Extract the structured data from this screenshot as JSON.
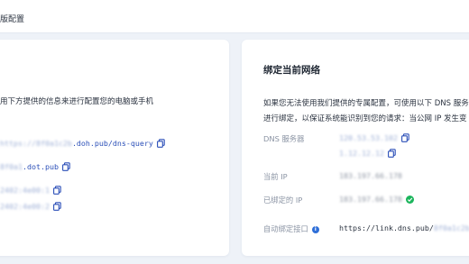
{
  "header": {
    "breadcrumb": "版配置"
  },
  "left_card": {
    "description": "用下方提供的信息来进行配置您的电脑或手机",
    "entries": [
      {
        "prefix_blurred": "https://8f0a1c2b",
        "text": ".doh.pub/dns-query"
      },
      {
        "prefix_blurred": "8f0a1",
        "text": ".dot.pub"
      },
      {
        "prefix_blurred": "2402:4e00:1",
        "text": ""
      },
      {
        "prefix_blurred": "2402:4e00:2",
        "text": ""
      }
    ]
  },
  "right_card": {
    "title": "绑定当前网络",
    "description_line1": "如果您无法使用我们提供的专属配置，可使用以下 DNS 服务",
    "description_line2": "进行绑定，以保证系统能识别到您的请求：当公网 IP 发生变",
    "labels": {
      "dns_server": "DNS 服务器",
      "current_ip": "当前 IP",
      "bound_ip": "已绑定的 IP",
      "auto_bind": "自动绑定接口"
    },
    "dns_servers": [
      "120.53.53.102",
      "1.12.12.12"
    ],
    "current_ip": "183.197.66.178",
    "bound_ip": "183.197.66.178",
    "auto_bind_url": "https://link.dns.pub/",
    "auto_bind_url_blurred": "8f0a1c2b3d"
  },
  "colors": {
    "link": "#2b4fb8",
    "success": "#1bb55c",
    "info": "#2f6fd8"
  }
}
